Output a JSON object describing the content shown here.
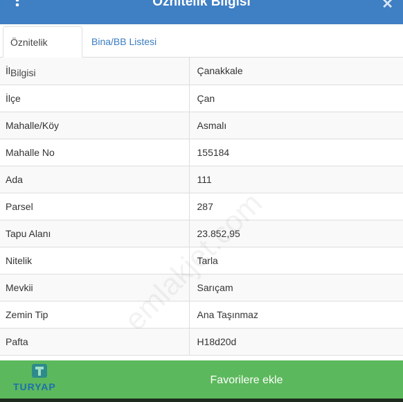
{
  "header": {
    "title": "Öznitelik Bilgisi",
    "menu_icon": "vertical-dots-icon",
    "close_icon": "close-icon"
  },
  "tabs": [
    {
      "label": "Öznitelik Bilgisi",
      "active": true
    },
    {
      "label": "Bina/BB Listesi",
      "active": false
    }
  ],
  "rows": [
    {
      "key": "İl",
      "value": "Çanakkale"
    },
    {
      "key": "İlçe",
      "value": "Çan"
    },
    {
      "key": "Mahalle/Köy",
      "value": "Asmalı"
    },
    {
      "key": "Mahalle No",
      "value": "155184"
    },
    {
      "key": "Ada",
      "value": "111"
    },
    {
      "key": "Parsel",
      "value": "287"
    },
    {
      "key": "Tapu Alanı",
      "value": "23.852,95"
    },
    {
      "key": "Nitelik",
      "value": "Tarla"
    },
    {
      "key": "Mevkii",
      "value": "Sarıçam"
    },
    {
      "key": "Zemin Tip",
      "value": "Ana Taşınmaz"
    },
    {
      "key": "Pafta",
      "value": "H18d20d"
    }
  ],
  "footer": {
    "favorite_label": "Favorilere ekle",
    "logo_text": "TURYAP"
  },
  "watermark": "emlakjet.com",
  "colors": {
    "header_bg": "#3f7fc4",
    "tab_link": "#3a7cc0",
    "footer_bg": "#5cb85c",
    "logo": "#1e6fb0"
  }
}
